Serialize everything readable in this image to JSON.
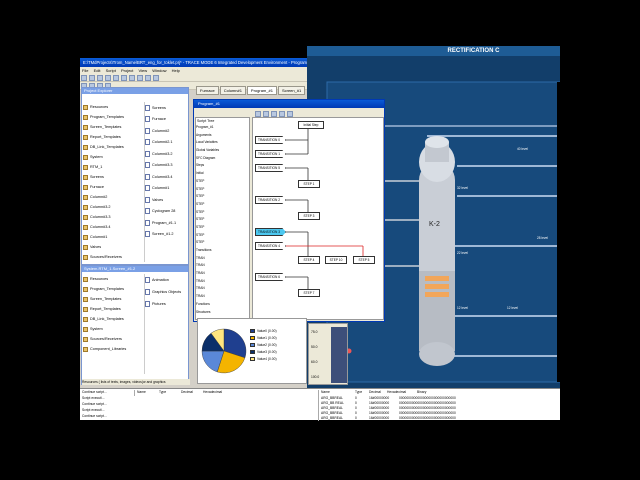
{
  "app": {
    "title": "E:\\TMdProjects\\Trom_Name\\BRT_eng_for_toklet.prj* - TRACE MODE 6 Integrated Development Environment - Program_Templates.Program_#1",
    "menu": [
      "File",
      "Edit",
      "Script",
      "Project",
      "View",
      "Window",
      "Help"
    ]
  },
  "tabs": [
    {
      "label": "Furnace"
    },
    {
      "label": "Column#1"
    },
    {
      "label": "Program_#1"
    },
    {
      "label": "Screen_#1"
    }
  ],
  "project_explorer": {
    "title": "Project Explorer",
    "left_items": [
      "Resources",
      "Program_Templates",
      "Screen_Templates",
      "Report_Templates",
      "DB_Link_Templates",
      "System",
      "RTM_1",
      "Screens",
      "Furnace",
      "Column#2",
      "Column#3.2",
      "Column#3.3",
      "Column#3.4",
      "Column#1",
      "Valves",
      "Sources/Receivers"
    ],
    "right_items": [
      "Screens",
      "Furnace",
      "Column#2",
      "Column#2.1",
      "Column#3.2",
      "Column#3.3",
      "Column#3.4",
      "Column#1",
      "Valves",
      "Cyclogram 28",
      "Program_#1.1",
      "Screen_#1.2"
    ]
  },
  "bottom_explorer": {
    "title": "System.RTM_1.Screen_#1.2",
    "left_items": [
      "Resources",
      "Program_Templates",
      "Screen_Templates",
      "Report_Templates",
      "DB_Link_Templates",
      "System",
      "Sources/Receivers",
      "Component_Libraries"
    ],
    "right_items": [
      "Animation",
      "Graphics Objects",
      "Pictures"
    ],
    "status": "Resources ( lists of texts, images, videos(or and graphics"
  },
  "program_window": {
    "title": "Program_#1",
    "tree_title": "Script Tree",
    "tree_items": [
      "Program_#1",
      "Arguments",
      "Local Variables",
      "Global Variables",
      "SFC Diagram",
      "Steps",
      "Initial",
      "STEP",
      "STEP",
      "STEP",
      "STEP",
      "STEP",
      "STEP",
      "STEP",
      "STEP",
      "STEP",
      "Transitions",
      "TRAN",
      "TRAN",
      "TRAN",
      "TRAN",
      "TRAN",
      "TRAN",
      "Functions",
      "Structures"
    ],
    "steps": [
      "Initial Step",
      "STEP 1",
      "STEP 3",
      "STEP 4",
      "STEP 10",
      "STEP 5",
      "STEP 7"
    ],
    "transitions": [
      "TRANSITION 0",
      "TRANSITION 1",
      "TRANSITION 5",
      "TRANSITION 2",
      "TRANSITION 3",
      "TRANSITION 4",
      "TRANSITION 6"
    ]
  },
  "pie_chart": {
    "legend": [
      "Value0 (0.00)",
      "Value1 (0.00)",
      "Value2 (0.00)",
      "Value3 (0.00)",
      "Value4 (0.00)"
    ],
    "colors": [
      "#1f3f8f",
      "#f4b400",
      "#5a88d8",
      "#0b2f6a",
      "#ffe680"
    ],
    "values": [
      0.3,
      0.25,
      0.2,
      0.15,
      0.1
    ]
  },
  "bar_panel": {
    "ticks": [
      "75.0",
      "50.0",
      "60.0",
      "100.0"
    ]
  },
  "hmi": {
    "title": "RECTIFICATION C",
    "vessel_label": "K-2",
    "levels": [
      "40 level",
      "32 level",
      "28 level",
      "22 level",
      "12 level",
      "12 level"
    ]
  },
  "table_left": {
    "rows": [
      "Continue script...",
      "Script executi...",
      "Continue script...",
      "Script executi...",
      "Continue script..."
    ]
  },
  "table_mid": {
    "headers": [
      "Name",
      "Type",
      "Decimal",
      "Hexadecimal"
    ]
  },
  "table_right": {
    "headers": [
      "Name",
      "Type",
      "Decimal",
      "Hexadecimal",
      "Binary"
    ],
    "rows": [
      [
        "ARG_BBREAL",
        "0",
        "16#00000000",
        "0000000000000000000000000000000"
      ],
      [
        "ARG_BB REAL",
        "0",
        "16#00000000",
        "0000000000000000000000000000000"
      ],
      [
        "ARG_BBREAL",
        "0",
        "16#00000000",
        "0000000000000000000000000000000"
      ],
      [
        "ARG_BBREAL",
        "0",
        "16#00000000",
        "0000000000000000000000000000000"
      ],
      [
        "ARG_BBREAL",
        "0",
        "16#00000000",
        "0000000000000000000000000000000"
      ]
    ]
  }
}
